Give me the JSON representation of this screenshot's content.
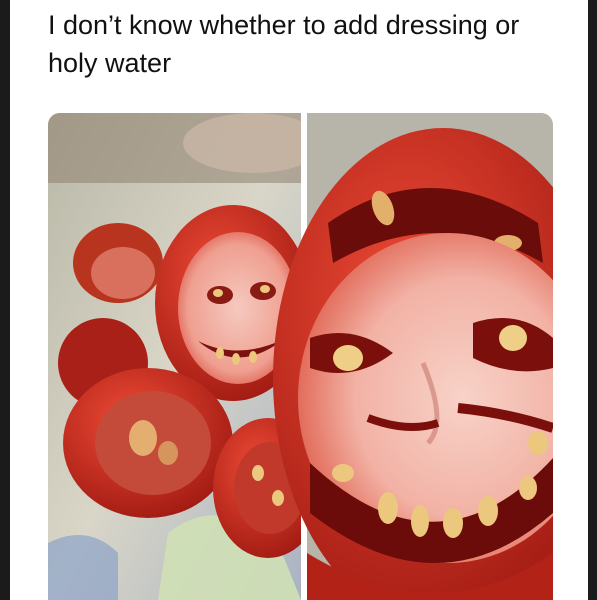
{
  "post": {
    "caption": "I don’t know whether to add dressing or holy water"
  },
  "image": {
    "subject": "tomato-slices-with-face",
    "colors": {
      "tomato_red": "#c62a1c",
      "tomato_dark": "#7a0f0c",
      "flesh_pink": "#f0b8ad",
      "seed_yellow": "#e8c47a",
      "background_cloth": "#cfcbbd"
    }
  }
}
